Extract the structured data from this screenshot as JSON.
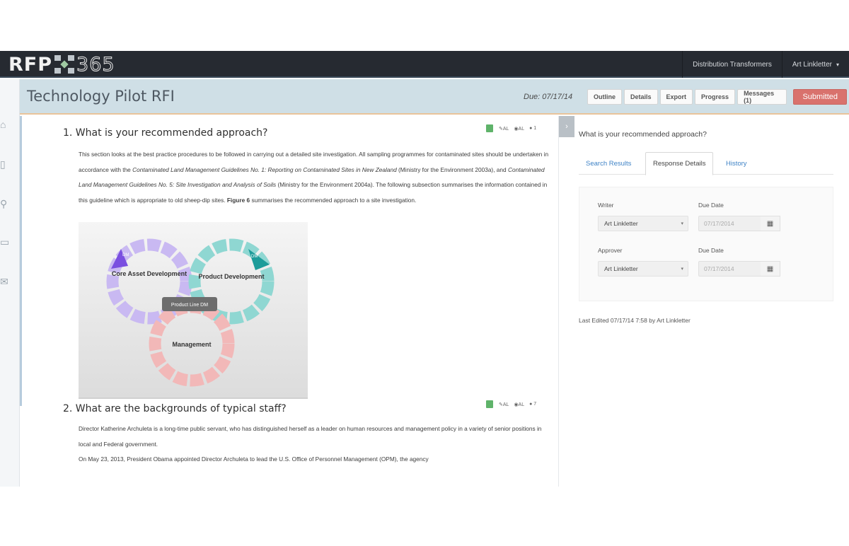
{
  "app": {
    "logo_left": "RFP",
    "logo_right": "365"
  },
  "nav": {
    "project": "Distribution Transformers",
    "user": "Art Linkletter"
  },
  "header": {
    "title": "Technology Pilot RFI",
    "due": "Due: 07/17/14",
    "buttons": [
      "Outline",
      "Details",
      "Export",
      "Progress",
      "Messages (1)"
    ],
    "status_button": "Submitted"
  },
  "questions": [
    {
      "title": "1. What is your recommended approach?",
      "tools": {
        "edit": "AL",
        "view": "AL",
        "count": "1"
      },
      "paragraph": {
        "s1": "This section looks at the best practice procedures to be followed in carrying out a detailed site investigation. All sampling programmes for contaminated sites should be undertaken in accordance with the ",
        "i1": "Contaminated Land Management Guidelines No. 1: Reporting on Contaminated Sites in New Zealand",
        "s2": " (Ministry for the Environment 2003a), and ",
        "i2": "Contaminated Land Management Guidelines No. 5: Site Investigation and Analysis of Soils",
        "s3": " (Ministry for the Environment 2004a). The following subsection summarises the information contained in this guideline which is appropriate to old sheep-dip sites. ",
        "b1": "Figure 6",
        "s4": " summarises the recommended approach to a site investigation."
      },
      "figure": {
        "cycle1": "Core Asset Development",
        "cycle2": "Product Development",
        "cycle3": "Management",
        "center": "Product Line DM",
        "tag1": "DM",
        "tag2": "DM"
      }
    },
    {
      "title": "2. What are the backgrounds of typical staff?",
      "tools": {
        "edit": "AL",
        "view": "AL",
        "count": "7"
      },
      "paragraph1": "Director Katherine Archuleta is a long-time public servant, who has distinguished herself as a leader on human resources and management policy in a variety of senior positions in local and Federal government.",
      "paragraph2": "On May 23, 2013, President Obama appointed Director Archuleta to lead the U.S. Office of Personnel Management (OPM), the agency"
    }
  ],
  "panel": {
    "question": "What is your recommended approach?",
    "tabs": [
      "Search Results",
      "Response Details",
      "History"
    ],
    "writer_label": "Writer",
    "writer_value": "Art Linkletter",
    "writer_due_label": "Due Date",
    "writer_due_value": "07/17/2014",
    "approver_label": "Approver",
    "approver_value": "Art Linkletter",
    "approver_due_label": "Due Date",
    "approver_due_value": "07/17/2014",
    "last_edited": "Last Edited 07/17/14 7:58 by Art Linkletter"
  },
  "icons": [
    "home-icon",
    "document-icon",
    "search-icon",
    "card-icon",
    "mail-icon",
    "pencil-icon",
    "eye-icon",
    "comment-icon",
    "calendar-icon",
    "chevron-right-icon"
  ]
}
